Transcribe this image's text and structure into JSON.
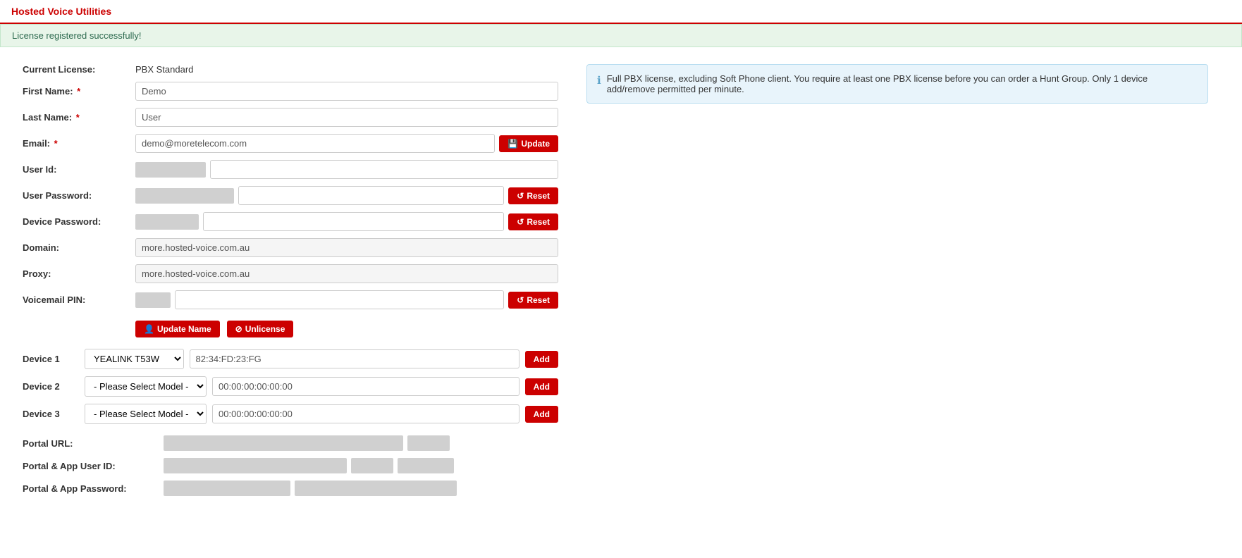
{
  "app": {
    "title": "Hosted Voice Utilities"
  },
  "banner": {
    "message": "License registered successfully!"
  },
  "form": {
    "current_license_label": "Current License:",
    "current_license_value": "PBX Standard",
    "first_name_label": "First Name:",
    "first_name_value": "Demo",
    "last_name_label": "Last Name:",
    "last_name_value": "User",
    "email_label": "Email:",
    "email_value": "demo@moretelecom.com",
    "user_id_label": "User Id:",
    "user_password_label": "User Password:",
    "device_password_label": "Device Password:",
    "domain_label": "Domain:",
    "domain_value": "more.hosted-voice.com.au",
    "proxy_label": "Proxy:",
    "proxy_value": "more.hosted-voice.com.au",
    "voicemail_pin_label": "Voicemail PIN:",
    "update_btn": "Update",
    "reset_btn": "Reset",
    "update_name_btn": "Update Name",
    "unlicense_btn": "Unlicense"
  },
  "devices": {
    "device1_label": "Device 1",
    "device2_label": "Device 2",
    "device3_label": "Device 3",
    "device1_model": "YEALINK T53W",
    "device2_model": "- Please Select Model -",
    "device3_model": "- Please Select Model -",
    "device1_mac": "82:34:FD:23:FG",
    "device2_mac": "00:00:00:00:00:00",
    "device3_mac": "00:00:00:00:00:00",
    "add_btn": "Add"
  },
  "portal": {
    "url_label": "Portal URL:",
    "user_id_label": "Portal & App User ID:",
    "password_label": "Portal & App Password:"
  },
  "info_box": {
    "text": "Full PBX license, excluding Soft Phone client. You require at least one PBX license before you can order a Hunt Group. Only 1 device add/remove permitted per minute."
  }
}
